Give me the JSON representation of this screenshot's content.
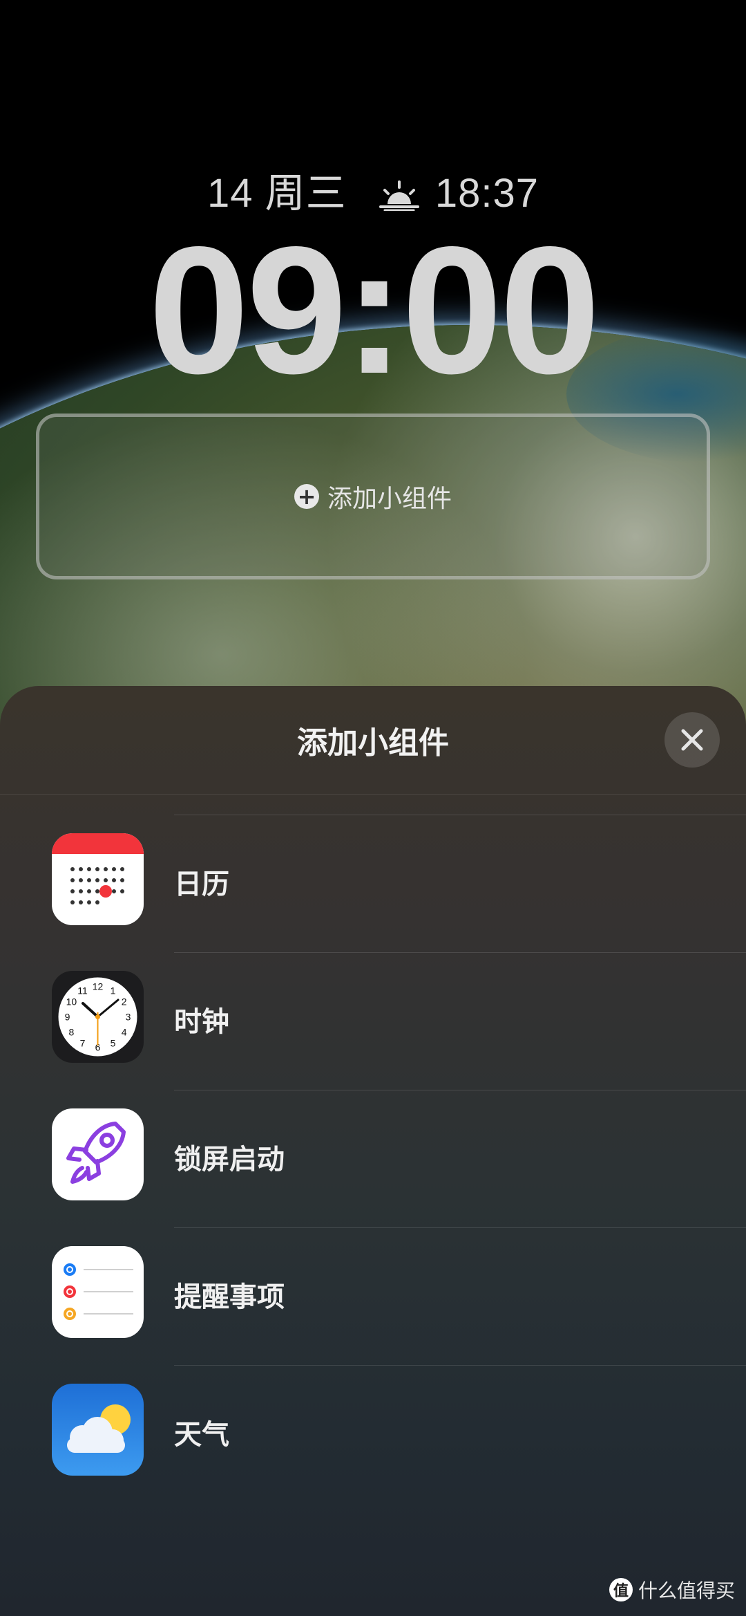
{
  "lock_screen": {
    "date": "14 周三",
    "sunset_time": "18:37",
    "time": "09:00",
    "widget_slot_label": "添加小组件",
    "icons": {
      "sunset": "sunset-icon",
      "add": "plus-circle-icon"
    }
  },
  "sheet": {
    "title": "添加小组件",
    "close_icon": "close-icon",
    "items": [
      {
        "label": "日历",
        "icon": "calendar-app-icon"
      },
      {
        "label": "时钟",
        "icon": "clock-app-icon"
      },
      {
        "label": "锁屏启动",
        "icon": "rocket-app-icon"
      },
      {
        "label": "提醒事项",
        "icon": "reminders-app-icon"
      },
      {
        "label": "天气",
        "icon": "weather-app-icon"
      }
    ]
  },
  "clock_face_numbers": [
    "12",
    "1",
    "2",
    "3",
    "4",
    "5",
    "6",
    "7",
    "8",
    "9",
    "10",
    "11"
  ],
  "watermark": {
    "badge": "值",
    "text": "什么值得买"
  },
  "colors": {
    "calendar_red": "#f2343b",
    "rocket_purple": "#8b3fe0",
    "weather_blue": "#1e6fd6"
  }
}
